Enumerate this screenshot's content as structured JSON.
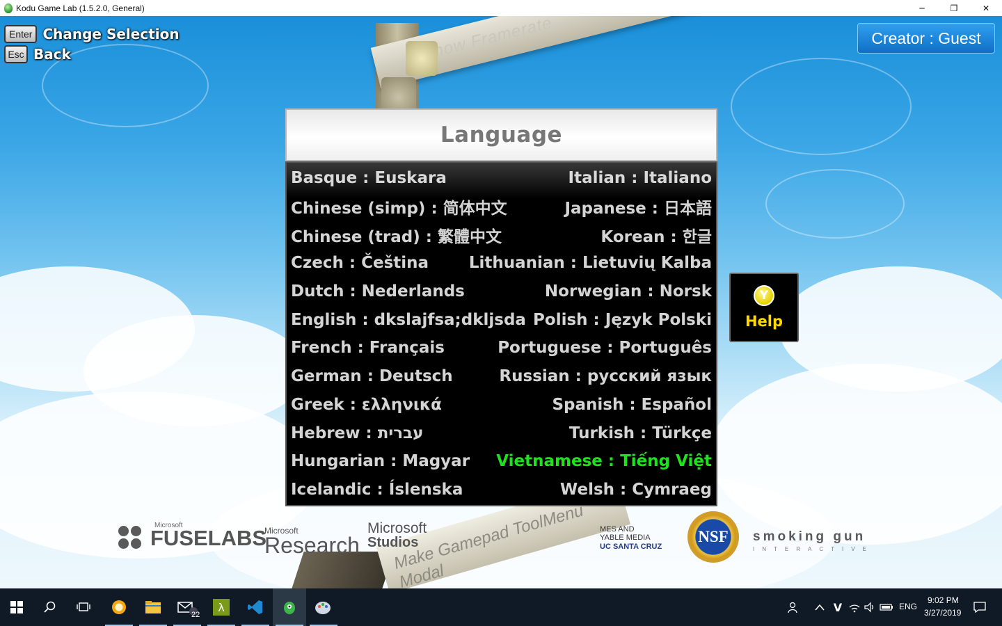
{
  "window": {
    "title": "Kodu Game Lab (1.5.2.0, General)",
    "controls": {
      "minimize": "─",
      "restore": "❐",
      "close": "✕"
    }
  },
  "key_hints": [
    {
      "key": "Enter",
      "label": "Change Selection"
    },
    {
      "key": "Esc",
      "label": "Back"
    }
  ],
  "creator_badge": "Creator : Guest",
  "background_signs": {
    "top": "Show Framerate",
    "bottom": "Make Gamepad ToolMenu Modal"
  },
  "language_panel": {
    "title": "Language",
    "selected": "Vietnamese : Tiếng Việt",
    "left_column": [
      "Basque : Euskara",
      "Chinese (simp) : 简体中文",
      "Chinese (trad) : 繁體中文",
      "Czech : Čeština",
      "Dutch : Nederlands",
      "English : dkslajfsa;dkljsda",
      "French : Français",
      "German : Deutsch",
      "Greek : ελληνικά",
      "Hebrew : עברית",
      "Hungarian : Magyar",
      "Icelandic : Íslenska"
    ],
    "right_column": [
      "Italian : Italiano",
      "Japanese : 日本語",
      "Korean : 한글",
      "Lithuanian : Lietuvių Kalba",
      "Norwegian : Norsk",
      "Polish : Język Polski",
      "Portuguese : Português",
      "Russian : русский язык",
      "Spanish : Español",
      "Turkish : Türkçe",
      "Vietnamese : Tiếng Việt",
      "Welsh : Cymraeg"
    ]
  },
  "help_button": {
    "key": "Y",
    "label": "Help"
  },
  "sponsors": {
    "fuse_small": "Microsoft",
    "fuse_big": "FUSELABS",
    "research_small": "Microsoft",
    "research_big": "Research",
    "studios_a": "Microsoft",
    "studios_b": "Studios",
    "games_media_1": "MES AND",
    "games_media_2": "YABLE MEDIA",
    "games_media_3": "UC SANTA CRUZ",
    "nsf": "NSF",
    "smoking_big": "smoking gun",
    "smoking_small": "INTERACTIVE"
  },
  "taskbar": {
    "mail_badge": "22",
    "language": "ENG",
    "time": "9:02 PM",
    "date": "3/27/2019"
  },
  "colors": {
    "selected_language": "#1fe21f",
    "help_label": "#ffd800",
    "creator_badge": "#1a88dc"
  }
}
